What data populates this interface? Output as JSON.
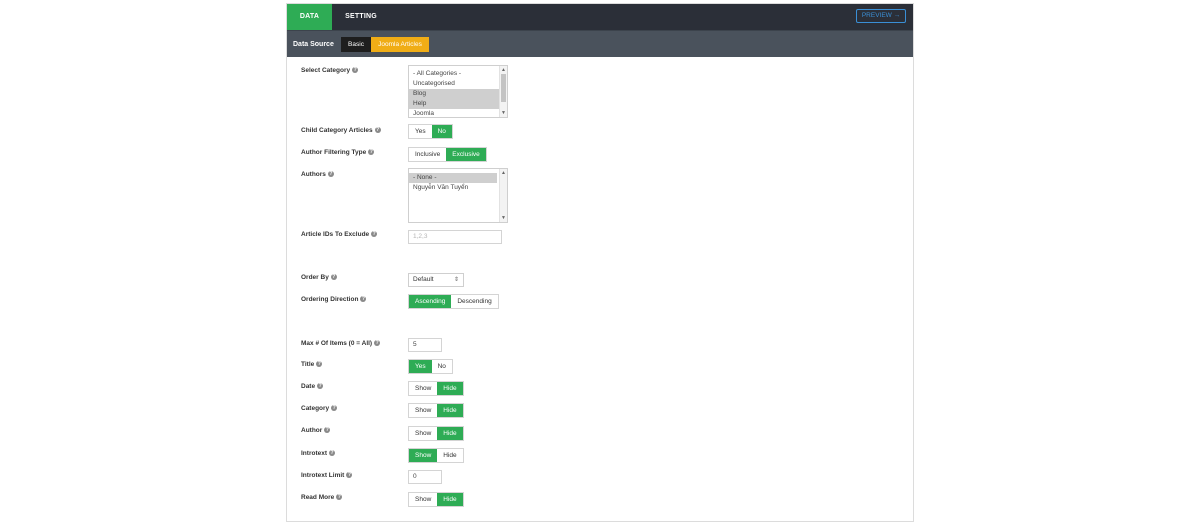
{
  "tabs": {
    "data": "DATA",
    "setting": "SETTING"
  },
  "preview_label": "PREVIEW →",
  "data_source": {
    "label": "Data Source",
    "basic": "Basic",
    "joomla": "Joomla Articles"
  },
  "help_glyph": "?",
  "select_category": {
    "label": "Select Category",
    "options": [
      "- All Categories -",
      "Uncategorised",
      "Blog",
      "Help",
      "Joomla"
    ],
    "selected": [
      "Blog",
      "Help"
    ]
  },
  "child_category": {
    "label": "Child Category Articles",
    "yes": "Yes",
    "no": "No",
    "value": "No"
  },
  "author_filtering": {
    "label": "Author Filtering Type",
    "inclusive": "Inclusive",
    "exclusive": "Exclusive",
    "value": "Exclusive"
  },
  "authors": {
    "label": "Authors",
    "options": [
      "- None -",
      "Nguyễn Văn Tuyển"
    ],
    "selected": [
      "- None -"
    ]
  },
  "exclude_ids": {
    "label": "Article IDs To Exclude",
    "placeholder": "1,2,3"
  },
  "order_by": {
    "label": "Order By",
    "value": "Default"
  },
  "ordering_direction": {
    "label": "Ordering Direction",
    "ascending": "Ascending",
    "descending": "Descending",
    "value": "Ascending"
  },
  "max_items": {
    "label": "Max # Of Items (0 = All)",
    "value": "5"
  },
  "title": {
    "label": "Title",
    "yes": "Yes",
    "no": "No",
    "value": "Yes"
  },
  "date": {
    "label": "Date",
    "show": "Show",
    "hide": "Hide",
    "value": "Hide"
  },
  "category": {
    "label": "Category",
    "show": "Show",
    "hide": "Hide",
    "value": "Hide"
  },
  "author": {
    "label": "Author",
    "show": "Show",
    "hide": "Hide",
    "value": "Hide"
  },
  "introtext": {
    "label": "Introtext",
    "show": "Show",
    "hide": "Hide",
    "value": "Show"
  },
  "introtext_limit": {
    "label": "Introtext Limit",
    "value": "0"
  },
  "read_more": {
    "label": "Read More",
    "show": "Show",
    "hide": "Hide",
    "value": "Hide"
  },
  "colors": {
    "accent_green": "#2eac55",
    "joomla_orange": "#f0ad16",
    "topbar_dark": "#2b2f38",
    "preview_blue": "#3a8fd6"
  }
}
